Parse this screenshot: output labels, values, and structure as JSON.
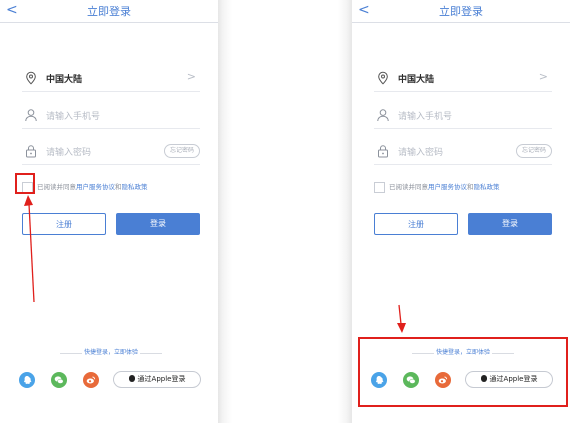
{
  "screens": [
    {
      "nav": {
        "back": "<",
        "title": "立即登录"
      },
      "region": "中国大陆",
      "region_chevron": ">",
      "phone_placeholder": "请输入手机号",
      "password_placeholder": "请输入密码",
      "forgot_password": "忘记密码",
      "agreement": {
        "prefix": "已阅读并同意",
        "user_agreement": "用户服务协议",
        "and": "和",
        "privacy": "隐私政策"
      },
      "register_label": "注册",
      "login_label": "登录",
      "quick_login": "快捷登录，立即体验",
      "apple_login": "通过Apple登录"
    },
    {
      "nav": {
        "back": "<",
        "title": "立即登录"
      },
      "region": "中国大陆",
      "region_chevron": ">",
      "phone_placeholder": "请输入手机号",
      "password_placeholder": "请输入密码",
      "forgot_password": "忘记密码",
      "agreement": {
        "prefix": "已阅读并同意",
        "user_agreement": "用户服务协议",
        "and": "和",
        "privacy": "隐私政策"
      },
      "register_label": "注册",
      "login_label": "登录",
      "quick_login": "快捷登录，立即体验",
      "apple_login": "通过Apple登录"
    }
  ],
  "icons": [
    "location-pin-icon",
    "user-icon",
    "lock-icon",
    "qq-icon",
    "wechat-icon",
    "weibo-icon",
    "apple-icon"
  ],
  "colors": {
    "accent": "#4a7fd4",
    "qq": "#4aa3e8",
    "wechat": "#5cb85c",
    "weibo": "#e86a3a",
    "annotation": "#e0201c"
  }
}
